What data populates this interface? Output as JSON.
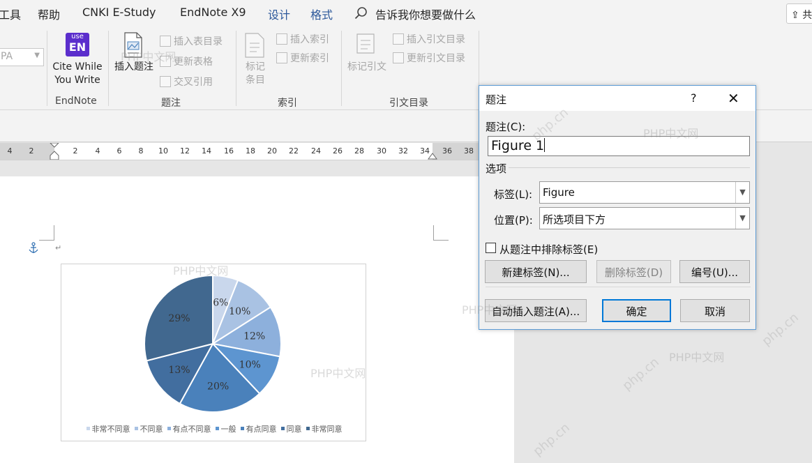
{
  "menu": {
    "items": [
      "工具",
      "帮助",
      "CNKI E-Study",
      "EndNote X9",
      "设计",
      "格式"
    ],
    "tell_me": "告诉我你想要做什么",
    "share": "共享"
  },
  "ribbon": {
    "style_combo_value": "PA",
    "endnote_logo": {
      "line1": "use",
      "line2": "EN"
    },
    "cite_while_you_write": {
      "line1": "Cite While",
      "line2": "You Write"
    },
    "insert_caption": "插入题注",
    "insert_table_of_figures": "插入表目录",
    "update_table": "更新表格",
    "cross_reference": "交叉引用",
    "mark_entry": {
      "line1": "标记",
      "line2": "条目"
    },
    "insert_index": "插入索引",
    "update_index": "更新索引",
    "mark_citation": "标记引文",
    "insert_table_of_authorities": "插入引文目录",
    "update_table_of_authorities": "更新引文目录",
    "groups": {
      "endnote": "EndNote",
      "captions": "题注",
      "index": "索引",
      "authorities": "引文目录"
    }
  },
  "ruler": {
    "ticks": [
      "4",
      "2",
      "2",
      "4",
      "6",
      "8",
      "10",
      "12",
      "14",
      "16",
      "18",
      "20",
      "22",
      "24",
      "26",
      "28",
      "30",
      "32",
      "34",
      "36",
      "38"
    ]
  },
  "document": {
    "chart_data": {
      "type": "pie",
      "categories": [
        "非常不同意",
        "不同意",
        "有点不同意",
        "一般",
        "有点同意",
        "同意",
        "非常同意"
      ],
      "values": [
        6,
        10,
        12,
        10,
        20,
        13,
        29
      ],
      "labels": [
        "6%",
        "10%",
        "12%",
        "10%",
        "20%",
        "13%",
        "29%"
      ],
      "colors": [
        "#c9d7ec",
        "#a9c2e3",
        "#8db0dc",
        "#5d95d0",
        "#4a81bb",
        "#426e9f",
        "#41688f"
      ],
      "legend": "bottom"
    }
  },
  "dialog": {
    "title": "题注",
    "help": "?",
    "caption_label": "题注(C):",
    "caption_value": "Figure 1",
    "options_heading": "选项",
    "label_label": "标签(L):",
    "label_value": "Figure",
    "position_label": "位置(P):",
    "position_value": "所选项目下方",
    "exclude_label": "从题注中排除标签(E)",
    "new_label_button": "新建标签(N)...",
    "delete_label_button": "删除标签(D)",
    "numbering_button": "编号(U)...",
    "autocaption_button": "自动插入题注(A)...",
    "ok_button": "确定",
    "cancel_button": "取消"
  },
  "watermarks": {
    "text": "PHP中文网",
    "site": "php.cn"
  }
}
